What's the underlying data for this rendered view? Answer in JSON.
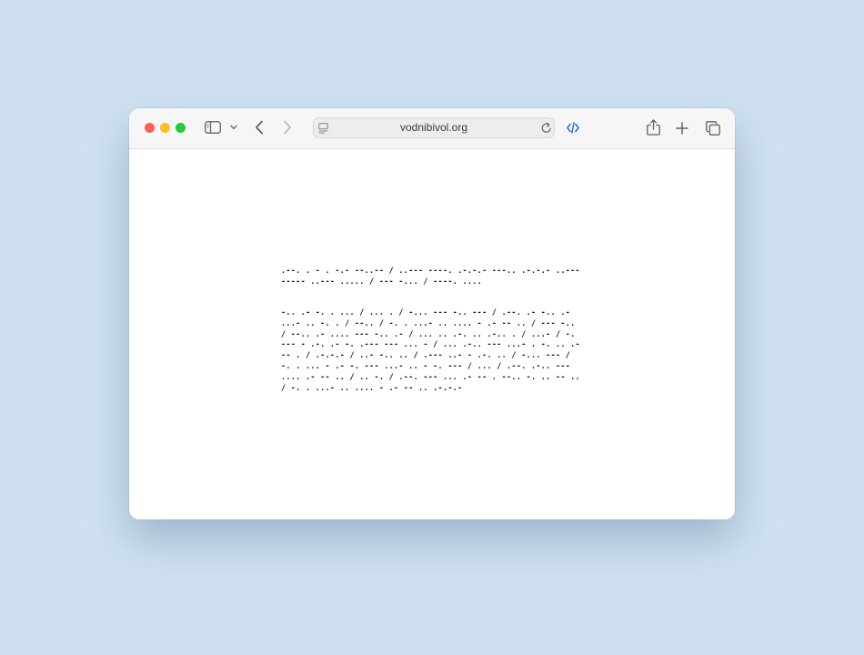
{
  "browser": {
    "url": "vodnibivol.org",
    "icons": {
      "sidebar": "sidebar-icon",
      "sidebar_menu": "chevron-down-icon",
      "back": "chevron-left-icon",
      "forward": "chevron-right-icon",
      "page_menu": "page-menu-icon",
      "reload": "reload-icon",
      "devtools": "code-icon",
      "share": "share-icon",
      "new_tab": "plus-icon",
      "tabs_overview": "tabs-icon"
    },
    "colors": {
      "background": "#cfe1f1",
      "close": "#ff5f57",
      "minimize": "#febc2e",
      "zoom": "#28c840",
      "accent": "#1f6fd1"
    }
  },
  "page": {
    "paragraph1": ".--. . - . -.- --..-- / ..--- ----. .-.-.- ---.. .-.-.- ..--- ----- ..--- ..... / --- -... / ----. ....",
    "paragraph2": "-.. .- -. . ... / ... . / -... --- -.. --- / .--. .- -.. .- ...- .. -. . / --.. / -. . ...- .. .... - .- -- .. / --- -.. / --.. .- .... --- -.. .- / ... .. .-. .. .-.. . / ...- / -. --- - .-. .- -. .--- --- ... - / ... .-.. --- ...- . -. .. .--- . / .-.-.- / ..- -.. .. / .--- ..- - .-. .. / -... --- / -. . ... - .- -. --- ...- .. - -. --- / ... / .--. .-.. --- .... .- -- .. / .. -. / .--. --- ... .- -- . --.. -. .. -- .. / -. . ...- .. .... - .- -- .. .-.-.-"
  }
}
